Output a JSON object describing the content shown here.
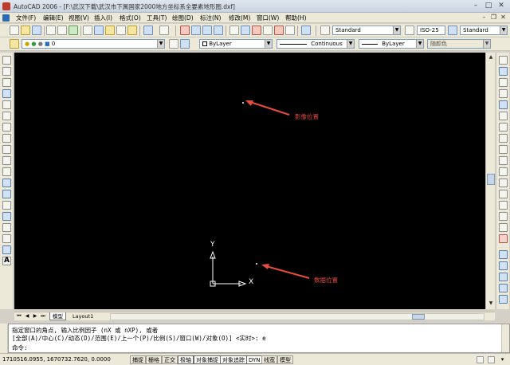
{
  "window": {
    "title": "AutoCAD 2006 - [F:\\武汉下载\\武汉市下属国家2000地方坐标系全要素地形图.dxf]",
    "minimize": "–",
    "maximize": "□",
    "close": "✕"
  },
  "menu": {
    "items": [
      "文件(F)",
      "编辑(E)",
      "视图(V)",
      "插入(I)",
      "格式(O)",
      "工具(T)",
      "绘图(D)",
      "标注(N)",
      "修改(M)",
      "窗口(W)",
      "帮助(H)"
    ],
    "mdi_minimize": "–",
    "mdi_restore": "❐",
    "mdi_close": "✕"
  },
  "toolbar": {
    "text_style": "Standard",
    "dim_style": "ISO-25",
    "table_style": "Standard",
    "layer": "0",
    "color": "ByLayer",
    "linetype": "Continuous",
    "lineweight": "ByLayer",
    "plot_style": "随颜色"
  },
  "tabs": {
    "model": "模型",
    "layout1": "Layout1"
  },
  "canvas": {
    "ucs_x": "X",
    "ucs_y": "Y",
    "annotation_top": "影像位置",
    "annotation_bottom": "数据位置"
  },
  "command": {
    "line1": "指定窗口的角点, 输入比例因子 (nX 或 nXP), 或者",
    "line2": "[全部(A)/中心(C)/动态(D)/范围(E)/上一个(P)/比例(S)/窗口(W)/对象(O)] <实时>: e",
    "prompt": "命令:"
  },
  "status": {
    "coordinates": "1710516.0955, 1670732.7620, 0.0000",
    "buttons": [
      "捕捉",
      "栅格",
      "正交",
      "极轴",
      "对象捕捉",
      "对象追踪",
      "DYN",
      "线宽",
      "模型"
    ]
  },
  "colors": {
    "canvas": "#000000",
    "annotation": "#e74c3c",
    "ucs": "#ffffff"
  }
}
